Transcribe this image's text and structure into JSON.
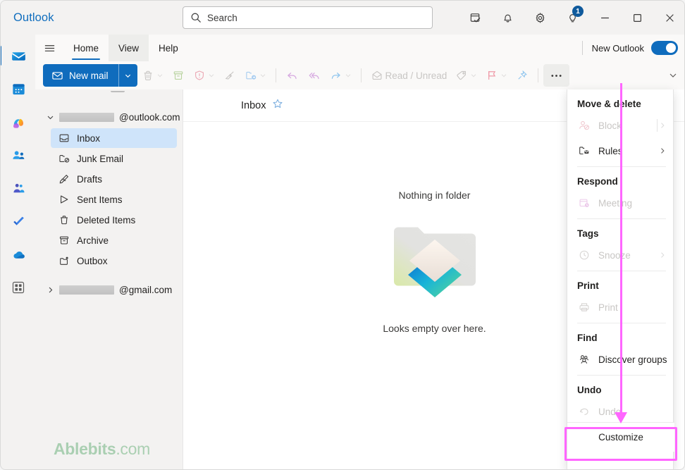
{
  "window": {
    "brand": "Outlook",
    "controls": {
      "minimize": "minimize-button",
      "maximize": "maximize-button",
      "close": "close-button"
    }
  },
  "search": {
    "placeholder": "Search",
    "icon": "search-icon"
  },
  "title_actions": [
    {
      "name": "notes-icon",
      "label": "Notes"
    },
    {
      "name": "bell-icon",
      "label": "Notifications"
    },
    {
      "name": "gear-icon",
      "label": "Settings"
    },
    {
      "name": "lightbulb-icon",
      "label": "Tips",
      "badge": "1"
    }
  ],
  "rail": {
    "items": [
      {
        "name": "mail-app-icon",
        "label": "Mail",
        "active": true
      },
      {
        "name": "calendar-app-icon",
        "label": "Calendar",
        "active": false
      },
      {
        "name": "copilot-app-icon",
        "label": "Copilot",
        "active": false
      },
      {
        "name": "people-app-icon",
        "label": "People",
        "active": false
      },
      {
        "name": "teams-app-icon",
        "label": "Teams",
        "active": false
      },
      {
        "name": "todo-app-icon",
        "label": "To Do",
        "active": false
      },
      {
        "name": "onedrive-app-icon",
        "label": "OneDrive",
        "active": false
      },
      {
        "name": "apps-grid-icon",
        "label": "More apps",
        "active": false
      }
    ]
  },
  "ribbon": {
    "hamburger": "hamburger-icon",
    "tabs": [
      {
        "label": "Home",
        "active": true
      },
      {
        "label": "View",
        "active": false
      },
      {
        "label": "Help",
        "active": false
      }
    ],
    "new_outlook_label": "New Outlook",
    "new_outlook_on": true
  },
  "commandbar": {
    "new_mail_label": "New mail",
    "read_unread_label": "Read / Unread",
    "more_label": "…",
    "icons": [
      {
        "name": "delete-icon",
        "has_chevron": true
      },
      {
        "name": "archive-icon",
        "has_chevron": false
      },
      {
        "name": "report-junk-icon",
        "has_chevron": true
      },
      {
        "name": "sweep-icon",
        "has_chevron": false
      },
      {
        "name": "move-to-icon",
        "has_chevron": true
      },
      {
        "name": "reply-icon",
        "has_chevron": false
      },
      {
        "name": "reply-all-icon",
        "has_chevron": false
      },
      {
        "name": "forward-icon",
        "has_chevron": true
      },
      {
        "name": "read-unread-icon",
        "has_chevron": false
      },
      {
        "name": "tag-icon",
        "has_chevron": true
      },
      {
        "name": "flag-icon",
        "has_chevron": true
      },
      {
        "name": "pin-icon",
        "has_chevron": false
      }
    ]
  },
  "folderpane": {
    "accounts": [
      {
        "email_suffix": "@outlook.com",
        "expanded": true,
        "folders": [
          {
            "label": "Inbox",
            "icon": "inbox-icon",
            "selected": true
          },
          {
            "label": "Junk Email",
            "icon": "junk-icon",
            "selected": false
          },
          {
            "label": "Drafts",
            "icon": "drafts-icon",
            "selected": false
          },
          {
            "label": "Sent Items",
            "icon": "sent-icon",
            "selected": false
          },
          {
            "label": "Deleted Items",
            "icon": "trash-icon",
            "selected": false
          },
          {
            "label": "Archive",
            "icon": "archive-folder-icon",
            "selected": false
          },
          {
            "label": "Outbox",
            "icon": "outbox-icon",
            "selected": false
          }
        ]
      },
      {
        "email_suffix": "@gmail.com",
        "expanded": false,
        "folders": []
      }
    ],
    "watermark_bold": "Ablebits",
    "watermark_light": ".com"
  },
  "listpane": {
    "title": "Inbox",
    "favorite_icon": "star-icon",
    "empty_title": "Nothing in folder",
    "empty_subtitle": "Looks empty over here."
  },
  "overflow_menu": {
    "groups": [
      {
        "section": "Move & delete",
        "items": [
          {
            "label": "Block",
            "icon": "block-sender-icon",
            "disabled": true,
            "chevron": true,
            "vsep": true
          },
          {
            "label": "Rules",
            "icon": "rules-icon",
            "disabled": false,
            "chevron": true,
            "vsep": false
          }
        ]
      },
      {
        "section": "Respond",
        "items": [
          {
            "label": "Meeting",
            "icon": "meeting-icon",
            "disabled": true,
            "chevron": false,
            "vsep": false
          }
        ]
      },
      {
        "section": "Tags",
        "items": [
          {
            "label": "Snooze",
            "icon": "snooze-clock-icon",
            "disabled": true,
            "chevron": true,
            "vsep": false
          }
        ]
      },
      {
        "section": "Print",
        "items": [
          {
            "label": "Print",
            "icon": "printer-icon",
            "disabled": true,
            "chevron": false,
            "vsep": false
          }
        ]
      },
      {
        "section": "Find",
        "items": [
          {
            "label": "Discover groups",
            "icon": "discover-groups-icon",
            "disabled": false,
            "chevron": false,
            "vsep": false
          }
        ]
      },
      {
        "section": "Undo",
        "items": [
          {
            "label": "Undo",
            "icon": "undo-icon",
            "disabled": true,
            "chevron": false,
            "vsep": false
          }
        ]
      }
    ],
    "customize_label": "Customize"
  },
  "annotation": {
    "color": "#ff66ff",
    "target": "Customize"
  }
}
